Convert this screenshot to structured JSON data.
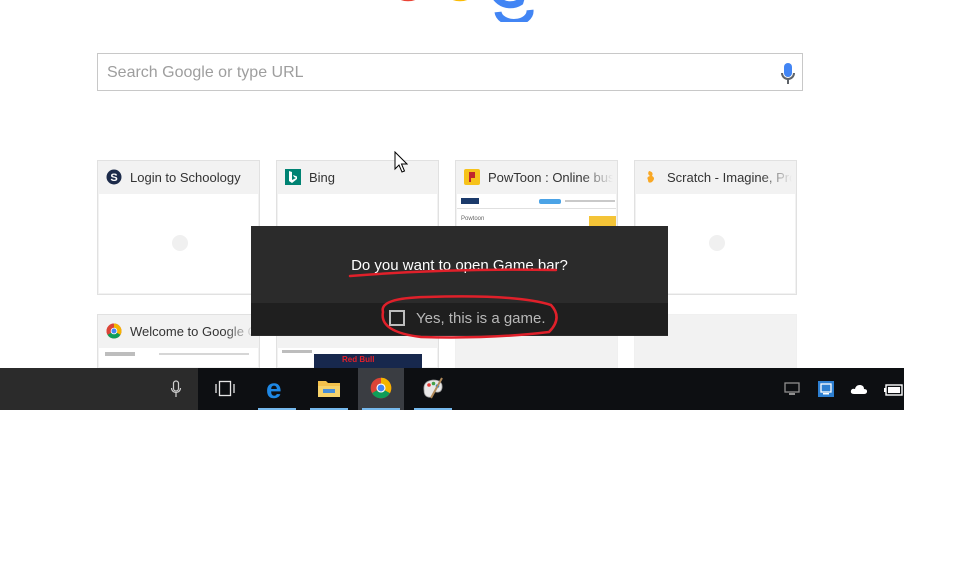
{
  "search": {
    "placeholder": "Search Google or type URL"
  },
  "tiles": [
    {
      "title": "Login to Schoology"
    },
    {
      "title": "Bing"
    },
    {
      "title": "PowToon : Online business"
    },
    {
      "title": "Scratch - Imagine, Program, Share"
    },
    {
      "title": "Welcome to Google Chrome"
    },
    {
      "title": ""
    },
    {
      "title": ""
    },
    {
      "title": ""
    }
  ],
  "thumbnails": {
    "powtoon_logo": "Powtoon",
    "redbull": "Red Bull"
  },
  "gamebar": {
    "question": "Do you want to open Game bar?",
    "checkbox_label": "Yes, this is a game."
  },
  "colors": {
    "annotation": "#e0202a",
    "taskbar_accent": "#76b9ed"
  },
  "taskbar": {
    "icons": [
      "microphone-icon",
      "task-view-icon",
      "edge-icon",
      "file-explorer-icon",
      "chrome-icon",
      "paint-icon"
    ],
    "tray": [
      "network-icon",
      "app-tray-icon",
      "onedrive-icon",
      "battery-icon"
    ]
  }
}
